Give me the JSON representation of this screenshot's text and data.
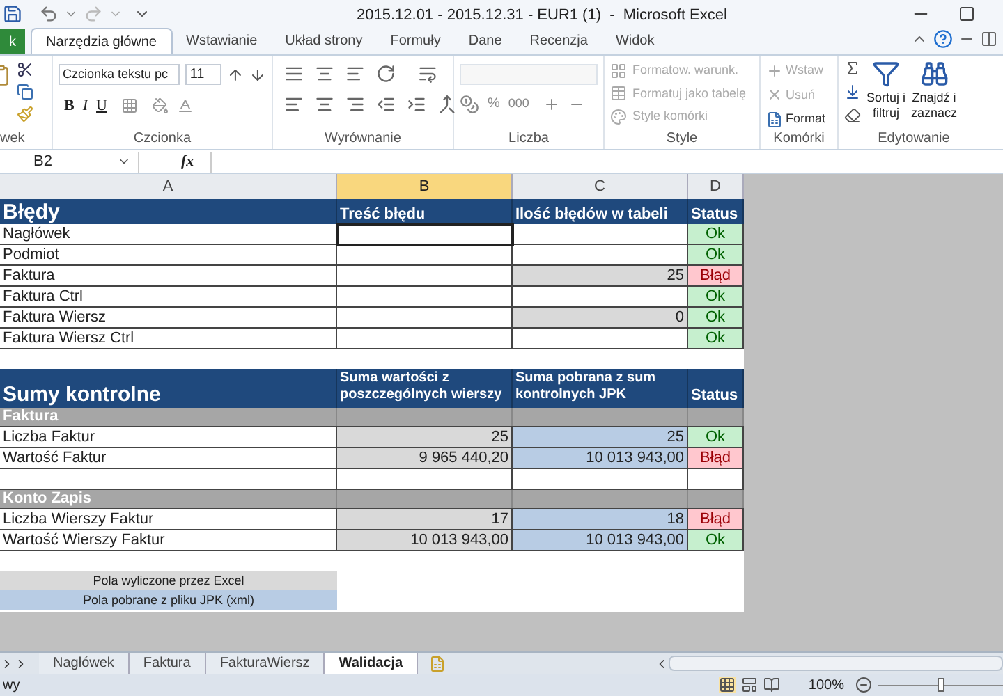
{
  "title_bar": {
    "title": "2015.12.01 - 2015.12.31 - EUR1 (1)  -  Microsoft Excel"
  },
  "ribbon": {
    "file_tab": "k",
    "tabs": [
      {
        "label": "Narzędzia główne",
        "selected": true
      },
      {
        "label": "Wstawianie",
        "selected": false
      },
      {
        "label": "Układ strony",
        "selected": false
      },
      {
        "label": "Formuły",
        "selected": false
      },
      {
        "label": "Dane",
        "selected": false
      },
      {
        "label": "Recenzja",
        "selected": false
      },
      {
        "label": "Widok",
        "selected": false
      }
    ],
    "clipboard": {
      "label": "wek"
    },
    "font": {
      "font_name": "Czcionka tekstu pc",
      "font_size": "11",
      "format_buttons": [
        "B",
        "I",
        "U"
      ],
      "label": "Czcionka"
    },
    "alignment": {
      "label": "Wyrównanie"
    },
    "number": {
      "percent": "%",
      "thousands": "000",
      "label": "Liczba"
    },
    "styles": {
      "items": [
        "Formatow. warunk.",
        "Formatuj jako tabelę",
        "Style komórki"
      ],
      "label": "Style"
    },
    "cells": {
      "items": [
        {
          "label": "Wstaw",
          "disabled": true
        },
        {
          "label": "Usuń",
          "disabled": true
        },
        {
          "label": "Format",
          "disabled": false
        }
      ],
      "label": "Komórki"
    },
    "editing": {
      "sort": [
        "Sortuj i",
        "filtruj"
      ],
      "find": [
        "Znajdź i",
        "zaznacz"
      ],
      "label": "Edytowanie"
    }
  },
  "formula_bar": {
    "name_box": "B2",
    "function_label": "fx"
  },
  "sheet": {
    "columns": [
      {
        "label": "A",
        "selected": false
      },
      {
        "label": "B",
        "selected": true
      },
      {
        "label": "C",
        "selected": false
      },
      {
        "label": "D",
        "selected": false
      }
    ],
    "rows": [
      {
        "kind": "title",
        "cells": [
          {
            "text": "Błędy"
          },
          {
            "text": "Treść błędu"
          },
          {
            "text": "Ilość błędów w tabeli"
          },
          {
            "text": "Status"
          }
        ]
      },
      {
        "kind": "data",
        "cells": [
          {
            "text": "Nagłówek",
            "kind": "white",
            "selected": false
          },
          {
            "kind": "white",
            "selected": true
          },
          {
            "kind": "white",
            "selected": false
          },
          {
            "text": "Ok",
            "kind": "ok",
            "selected": false
          }
        ]
      },
      {
        "kind": "data",
        "cells": [
          {
            "text": "Podmiot",
            "kind": "white",
            "selected": false
          },
          {
            "kind": "white",
            "selected": false
          },
          {
            "kind": "white",
            "selected": false
          },
          {
            "text": "Ok",
            "kind": "ok",
            "selected": false
          }
        ]
      },
      {
        "kind": "data",
        "cells": [
          {
            "text": "Faktura",
            "kind": "white",
            "selected": false
          },
          {
            "kind": "white",
            "selected": false
          },
          {
            "text": "25",
            "kind": "calc",
            "selected": false
          },
          {
            "text": "Błąd",
            "kind": "error",
            "selected": false
          }
        ]
      },
      {
        "kind": "data",
        "cells": [
          {
            "text": "Faktura Ctrl",
            "kind": "white",
            "selected": false
          },
          {
            "kind": "white",
            "selected": false
          },
          {
            "kind": "white",
            "selected": false
          },
          {
            "text": "Ok",
            "kind": "ok",
            "selected": false
          }
        ]
      },
      {
        "kind": "data",
        "cells": [
          {
            "text": "Faktura Wiersz",
            "kind": "white",
            "selected": false
          },
          {
            "kind": "white",
            "selected": false
          },
          {
            "text": "0",
            "kind": "calc",
            "selected": false
          },
          {
            "text": "Ok",
            "kind": "ok",
            "selected": false
          }
        ]
      },
      {
        "kind": "data",
        "cells": [
          {
            "text": "Faktura Wiersz Ctrl",
            "kind": "white",
            "selected": false
          },
          {
            "kind": "white",
            "selected": false
          },
          {
            "kind": "white",
            "selected": false
          },
          {
            "text": "Ok",
            "kind": "ok",
            "selected": false
          }
        ]
      },
      {
        "kind": "blank"
      },
      {
        "kind": "title2",
        "cells": [
          {
            "text": "Sumy kontrolne"
          },
          {
            "text": "Suma wartości z poszczególnych wierszy"
          },
          {
            "text": "Suma pobrana z sum kontrolnych JPK"
          },
          {
            "text": "Status"
          }
        ]
      },
      {
        "kind": "section",
        "cells": [
          {
            "text": "Faktura"
          }
        ]
      },
      {
        "kind": "data",
        "cells": [
          {
            "text": "Liczba Faktur",
            "kind": "white",
            "selected": false
          },
          {
            "text": "25",
            "kind": "calc",
            "selected": false
          },
          {
            "text": "25",
            "kind": "jpk",
            "selected": false
          },
          {
            "text": "Ok",
            "kind": "ok",
            "selected": false
          }
        ]
      },
      {
        "kind": "data",
        "cells": [
          {
            "text": "Wartość Faktur",
            "kind": "white",
            "selected": false
          },
          {
            "text": "9 965 440,20",
            "kind": "calc",
            "selected": false
          },
          {
            "text": "10 013 943,00",
            "kind": "jpk",
            "selected": false
          },
          {
            "text": "Błąd",
            "kind": "error",
            "selected": false
          }
        ]
      },
      {
        "kind": "data",
        "cells": [
          {
            "kind": "white",
            "selected": false
          },
          {
            "kind": "white",
            "selected": false
          },
          {
            "kind": "white",
            "selected": false
          },
          {
            "kind": "white",
            "selected": false
          }
        ]
      },
      {
        "kind": "section",
        "cells": [
          {
            "text": "Konto Zapis"
          }
        ]
      },
      {
        "kind": "data",
        "cells": [
          {
            "text": "Liczba Wierszy Faktur",
            "kind": "white",
            "selected": false
          },
          {
            "text": "17",
            "kind": "calc",
            "selected": false
          },
          {
            "text": "18",
            "kind": "jpk",
            "selected": false
          },
          {
            "text": "Błąd",
            "kind": "error",
            "selected": false
          }
        ]
      },
      {
        "kind": "data",
        "cells": [
          {
            "text": "Wartość Wierszy Faktur",
            "kind": "white",
            "selected": false
          },
          {
            "text": "10 013 943,00",
            "kind": "calc",
            "selected": false
          },
          {
            "text": "10 013 943,00",
            "kind": "jpk",
            "selected": false
          },
          {
            "text": "Ok",
            "kind": "ok",
            "selected": false
          }
        ]
      },
      {
        "kind": "blank"
      },
      {
        "kind": "legend",
        "cells": [
          {
            "text": "Pola wyliczone przez Excel",
            "kind": "calc"
          }
        ]
      },
      {
        "kind": "legend",
        "cells": [
          {
            "text": "Pola pobrane z pliku JPK (xml)",
            "kind": "jpk"
          }
        ]
      }
    ]
  },
  "sheet_tabs": [
    {
      "label": "Nagłówek",
      "selected": false
    },
    {
      "label": "Faktura",
      "selected": false
    },
    {
      "label": "FakturaWiersz",
      "selected": false
    },
    {
      "label": "Walidacja",
      "selected": true
    }
  ],
  "status_bar": {
    "mode": "wy",
    "zoom": "100%",
    "zoom_slider": {
      "level": 0.5
    }
  }
}
